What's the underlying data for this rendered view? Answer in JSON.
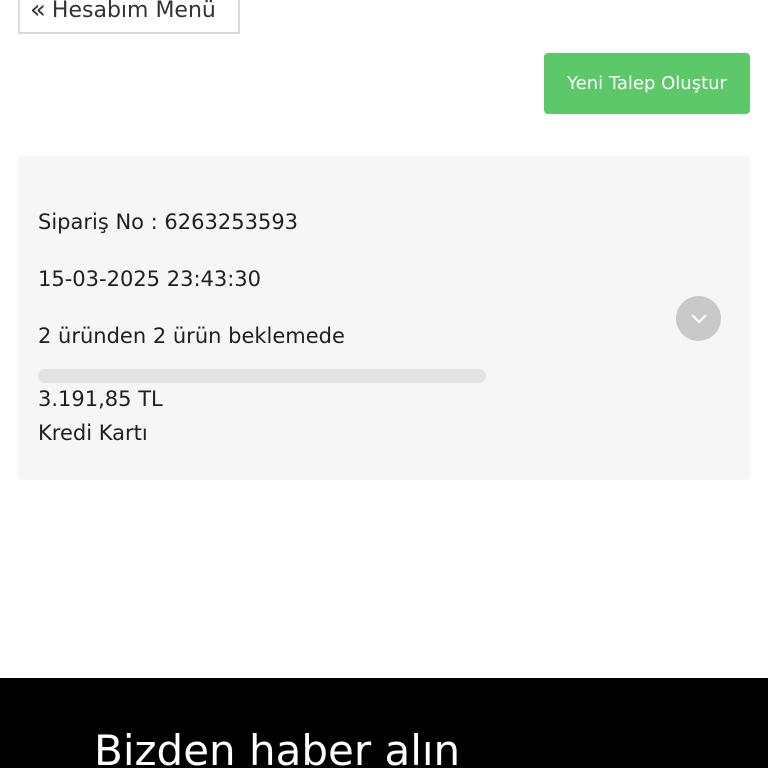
{
  "header": {
    "back_label": "Hesabım Menü",
    "back_icon": "double-chevron-left-icon"
  },
  "actions": {
    "new_request_label": "Yeni Talep Oluştur",
    "accent_color": "#5dc86a"
  },
  "order": {
    "order_number_line": "Sipariş No : 6263253593",
    "datetime": "15-03-2025 23:43:30",
    "status": "2 üründen 2 ürün beklemede",
    "progress_fraction": 0,
    "total": "3.191,85 TL",
    "payment_method": "Kredi Kartı",
    "toggle_icon": "chevron-down-icon"
  },
  "footer": {
    "heading": "Bizden haber alın"
  }
}
